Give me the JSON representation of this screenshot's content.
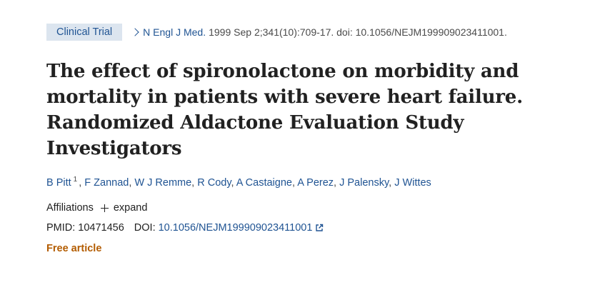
{
  "header": {
    "badge": "Clinical Trial",
    "journal": "N Engl J Med.",
    "citation": "1999 Sep 2;341(10):709-17. doi: 10.1056/NEJM199909023411001."
  },
  "title": "The effect of spironolactone on morbidity and mortality in patients with severe heart failure. Randomized Aldactone Evaluation Study Investigators",
  "authors": [
    {
      "name": "B Pitt",
      "sup": "1"
    },
    {
      "name": "F Zannad"
    },
    {
      "name": "W J Remme"
    },
    {
      "name": "R Cody"
    },
    {
      "name": "A Castaigne"
    },
    {
      "name": "A Perez"
    },
    {
      "name": "J Palensky"
    },
    {
      "name": "J Wittes"
    }
  ],
  "affiliations": {
    "label": "Affiliations",
    "expand": "expand"
  },
  "ids": {
    "pmid_label": "PMID:",
    "pmid": "10471456",
    "doi_label": "DOI:",
    "doi": "10.1056/NEJM199909023411001"
  },
  "free_article": "Free article",
  "icons": {
    "chevron": "chevron-right-icon",
    "plus": "plus-icon",
    "external": "external-link-icon"
  },
  "colors": {
    "link": "#205493",
    "badge_bg": "#dce5ef",
    "free": "#b35c00"
  }
}
